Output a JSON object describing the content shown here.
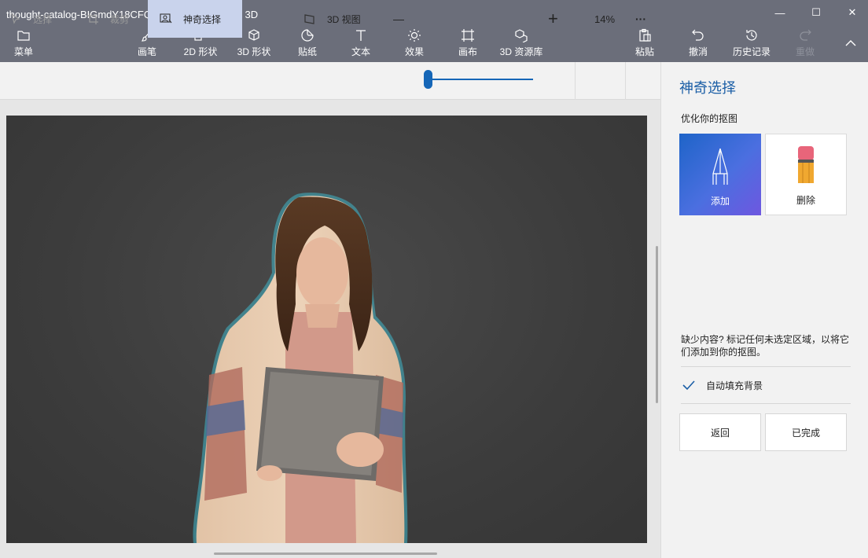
{
  "window": {
    "title": "thought-catalog-BIGmdY18CFQ-unsplash.jpg - 画图 3D",
    "minimize": "—",
    "maximize": "☐",
    "close": "✕"
  },
  "toolbar": {
    "menu": "菜单",
    "brushes": "画笔",
    "shapes2d": "2D 形状",
    "shapes3d": "3D 形状",
    "stickers": "贴纸",
    "text": "文本",
    "effects": "效果",
    "canvas": "画布",
    "library3d": "3D 资源库",
    "paste": "粘贴",
    "undo": "撤消",
    "history": "历史记录",
    "redo": "重做"
  },
  "subbar": {
    "select": "选择",
    "crop": "裁剪",
    "magic_select": "神奇选择",
    "view3d": "3D 视图",
    "zoom_minus": "—",
    "zoom_plus": "+",
    "zoom_level": "14%",
    "more": "···",
    "zoom_fraction": 0.05
  },
  "panel": {
    "title": "神奇选择",
    "subtitle": "优化你的抠图",
    "add_label": "添加",
    "remove_label": "删除",
    "hint": "缺少内容? 标记任何未选定区域，以将它们添加到你的抠图。",
    "autofill_label": "自动填充背景",
    "autofill_checked": true,
    "back_button": "返回",
    "done_button": "已完成"
  },
  "colors": {
    "titlebar": "#6b6e7a",
    "accent": "#1566b7",
    "panel_title": "#1b5ea6"
  }
}
